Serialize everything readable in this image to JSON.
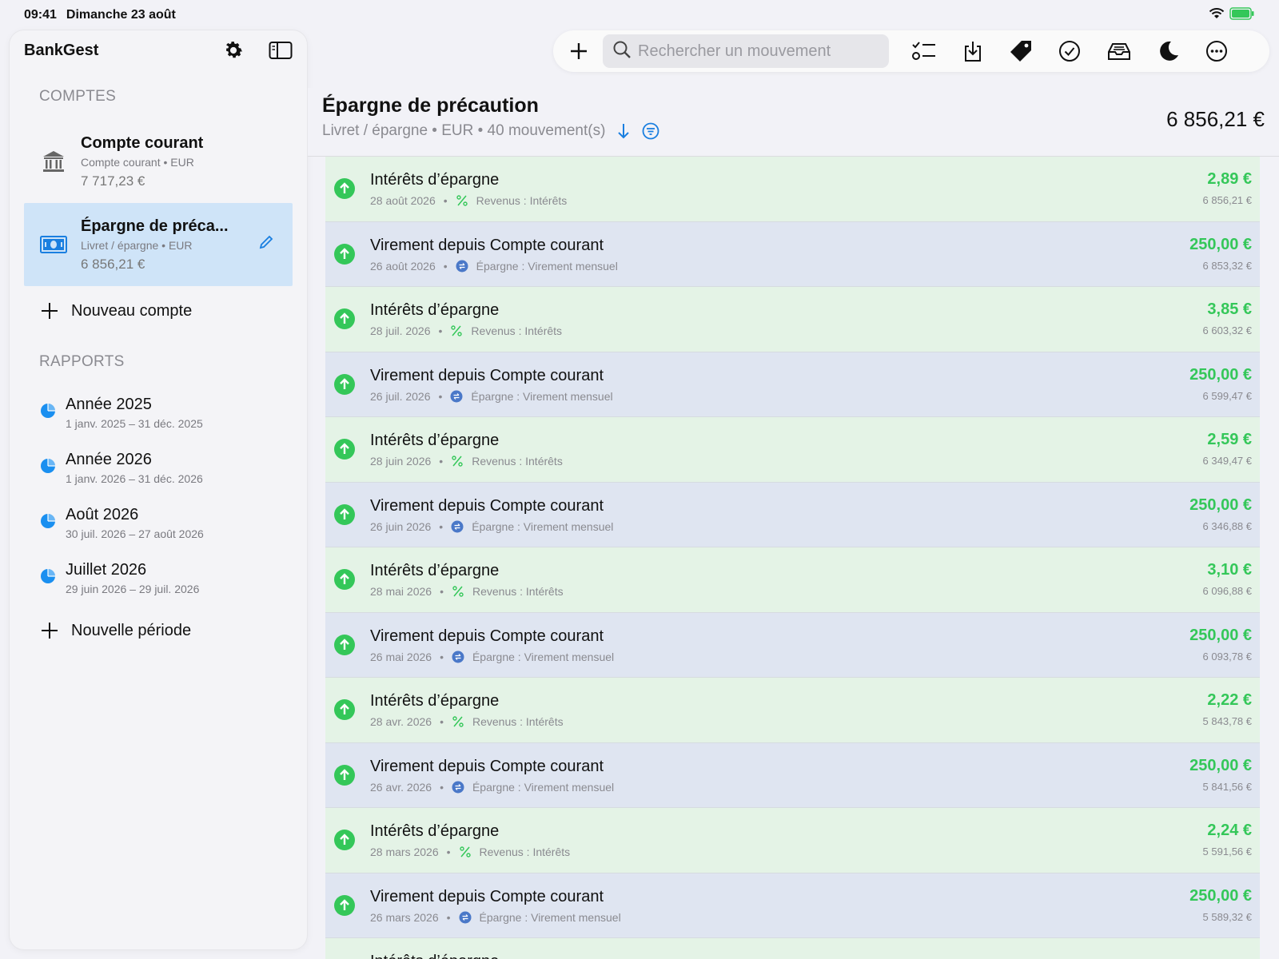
{
  "status": {
    "time": "09:41",
    "date": "Dimanche 23 août"
  },
  "sidebar": {
    "app_title": "BankGest",
    "accounts_title": "COMPTES",
    "accounts": [
      {
        "name": "Compte courant",
        "sub": "Compte courant • EUR",
        "balance": "7 717,23 €",
        "icon": "bank-icon",
        "selected": false
      },
      {
        "name": "Épargne de préca...",
        "sub": "Livret / épargne • EUR",
        "balance": "6 856,21 €",
        "icon": "banknote-icon",
        "selected": true
      }
    ],
    "new_account": "Nouveau compte",
    "reports_title": "RAPPORTS",
    "reports": [
      {
        "name": "Année 2025",
        "range": "1 janv. 2025 – 31 déc. 2025"
      },
      {
        "name": "Année 2026",
        "range": "1 janv. 2026 – 31 déc. 2026"
      },
      {
        "name": "Août 2026",
        "range": "30 juil. 2026 – 27 août 2026"
      },
      {
        "name": "Juillet 2026",
        "range": "29 juin 2026 – 29 juil. 2026"
      }
    ],
    "new_period": "Nouvelle période"
  },
  "toolbar": {
    "search_placeholder": "Rechercher un mouvement",
    "icons": [
      "add-icon",
      "checklist-icon",
      "import-icon",
      "tag-icon",
      "checkmark-circle-icon",
      "inbox-icon",
      "moon-icon",
      "more-icon"
    ]
  },
  "main": {
    "title": "Épargne de précaution",
    "subtitle": "Livret / épargne • EUR • 40 mouvement(s)",
    "total": "6 856,21 €",
    "transactions": [
      {
        "type": "interest",
        "title": "Intérêts d’épargne",
        "date": "28 août 2026",
        "category": "Revenus : Intérêts",
        "amount": "2,89 €",
        "balance": "6 856,21 €"
      },
      {
        "type": "transfer",
        "title": "Virement depuis Compte courant",
        "date": "26 août 2026",
        "category": "Épargne : Virement mensuel",
        "amount": "250,00 €",
        "balance": "6 853,32 €"
      },
      {
        "type": "interest",
        "title": "Intérêts d’épargne",
        "date": "28 juil. 2026",
        "category": "Revenus : Intérêts",
        "amount": "3,85 €",
        "balance": "6 603,32 €"
      },
      {
        "type": "transfer",
        "title": "Virement depuis Compte courant",
        "date": "26 juil. 2026",
        "category": "Épargne : Virement mensuel",
        "amount": "250,00 €",
        "balance": "6 599,47 €"
      },
      {
        "type": "interest",
        "title": "Intérêts d’épargne",
        "date": "28 juin 2026",
        "category": "Revenus : Intérêts",
        "amount": "2,59 €",
        "balance": "6 349,47 €"
      },
      {
        "type": "transfer",
        "title": "Virement depuis Compte courant",
        "date": "26 juin 2026",
        "category": "Épargne : Virement mensuel",
        "amount": "250,00 €",
        "balance": "6 346,88 €"
      },
      {
        "type": "interest",
        "title": "Intérêts d’épargne",
        "date": "28 mai 2026",
        "category": "Revenus : Intérêts",
        "amount": "3,10 €",
        "balance": "6 096,88 €"
      },
      {
        "type": "transfer",
        "title": "Virement depuis Compte courant",
        "date": "26 mai 2026",
        "category": "Épargne : Virement mensuel",
        "amount": "250,00 €",
        "balance": "6 093,78 €"
      },
      {
        "type": "interest",
        "title": "Intérêts d’épargne",
        "date": "28 avr. 2026",
        "category": "Revenus : Intérêts",
        "amount": "2,22 €",
        "balance": "5 843,78 €"
      },
      {
        "type": "transfer",
        "title": "Virement depuis Compte courant",
        "date": "26 avr. 2026",
        "category": "Épargne : Virement mensuel",
        "amount": "250,00 €",
        "balance": "5 841,56 €"
      },
      {
        "type": "interest",
        "title": "Intérêts d’épargne",
        "date": "28 mars 2026",
        "category": "Revenus : Intérêts",
        "amount": "2,24 €",
        "balance": "5 591,56 €"
      },
      {
        "type": "transfer",
        "title": "Virement depuis Compte courant",
        "date": "26 mars 2026",
        "category": "Épargne : Virement mensuel",
        "amount": "250,00 €",
        "balance": "5 589,32 €"
      },
      {
        "type": "interest",
        "title": "Intérêts d’épargne",
        "date": "",
        "category": "",
        "amount": "",
        "balance": ""
      }
    ]
  },
  "colors": {
    "accent": "#1a7fe0",
    "positive": "#34c759",
    "interest_row": "#e4f3e6",
    "transfer_row": "#dfe5f1",
    "selected": "#cfe4f8"
  }
}
